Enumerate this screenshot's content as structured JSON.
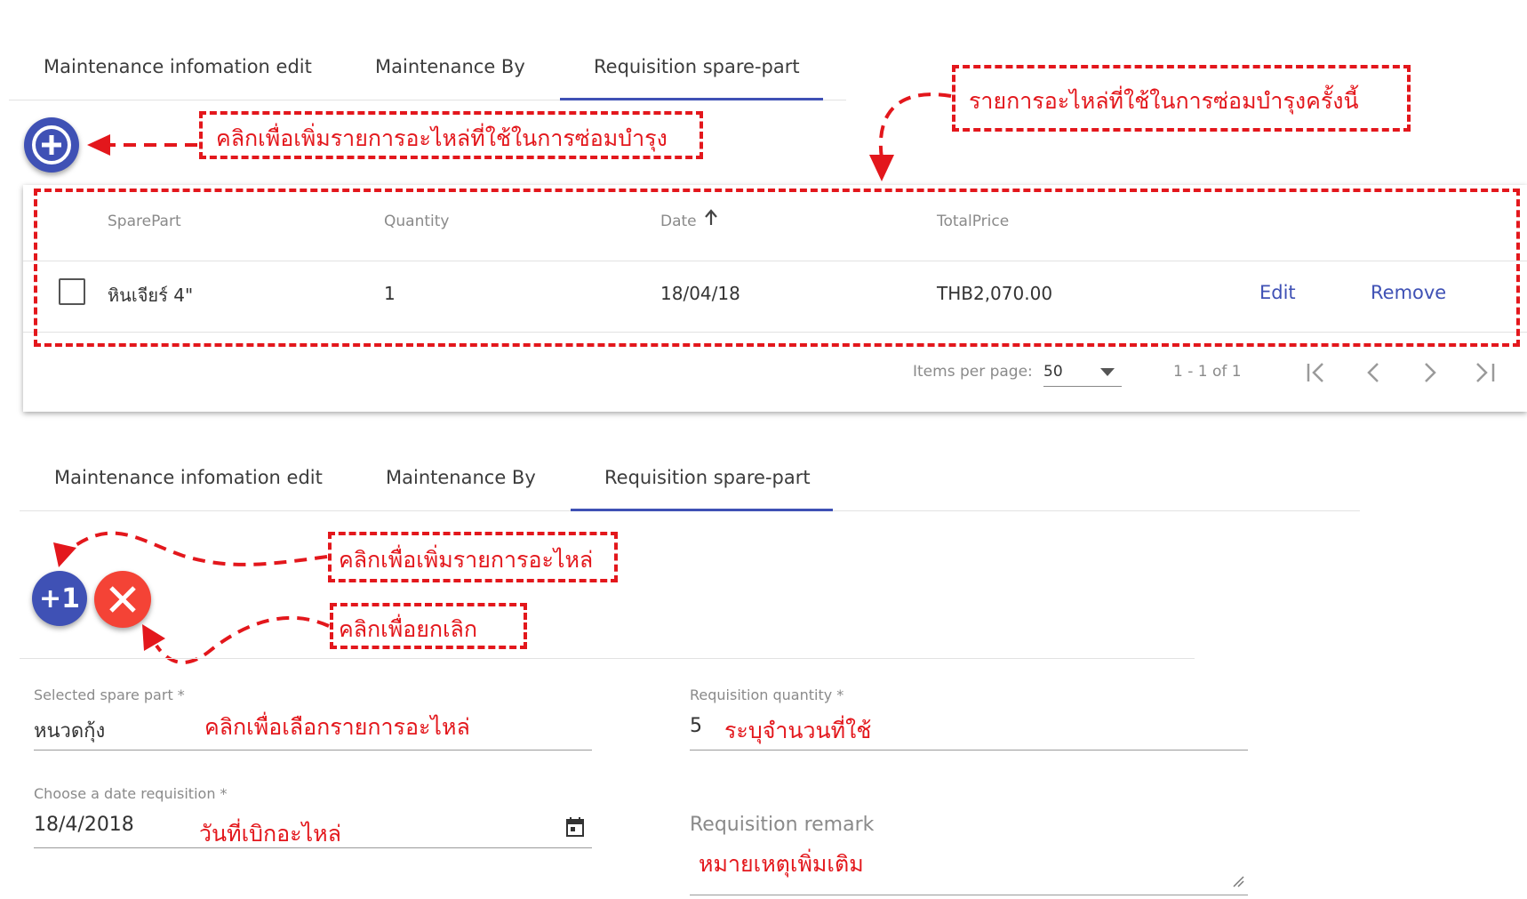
{
  "top": {
    "tabs": [
      {
        "label": "Maintenance infomation edit"
      },
      {
        "label": "Maintenance By"
      },
      {
        "label": "Requisition spare-part"
      }
    ],
    "annot_add": "คลิกเพื่อเพิ่มรายการอะไหล่ที่ใช้ในการซ่อมบำรุง",
    "annot_list": "รายการอะไหล่ที่ใช้ในการซ่อมบำรุงครั้งนี้",
    "table": {
      "headers": [
        "SparePart",
        "Quantity",
        "Date",
        "TotalPrice"
      ],
      "sort_icon": "arrow-up-icon",
      "rows": [
        {
          "sparepart": "หินเจียร์ 4\"",
          "quantity": "1",
          "date": "18/04/18",
          "total": "THB2,070.00",
          "edit": "Edit",
          "remove": "Remove"
        }
      ]
    },
    "paginator": {
      "items_label": "Items per page:",
      "page_size": "50",
      "range": "1 - 1 of 1"
    }
  },
  "bottom": {
    "tabs": [
      {
        "label": "Maintenance infomation edit"
      },
      {
        "label": "Maintenance By"
      },
      {
        "label": "Requisition spare-part"
      }
    ],
    "add_button": "+1",
    "annot_add": "คลิกเพื่อเพิ่มรายการอะไหล่",
    "annot_cancel": "คลิกเพื่อยกเลิก",
    "form": {
      "spare_label": "Selected spare part *",
      "spare_value": "หนวดกุ้ง",
      "spare_annot": "คลิกเพื่อเลือกรายการอะไหล่",
      "qty_label": "Requisition quantity *",
      "qty_value": "5",
      "qty_annot": "ระบุจำนวนที่ใช้",
      "date_label": "Choose a date requisition *",
      "date_value": "18/4/2018",
      "date_annot": "วันที่เบิกอะไหล่",
      "remark_placeholder": "Requisition remark",
      "remark_annot": "หมายเหตุเพิ่มเติม"
    }
  },
  "colors": {
    "accent": "#3f51b5",
    "danger": "#f44336",
    "annotation": "#e3171c"
  }
}
